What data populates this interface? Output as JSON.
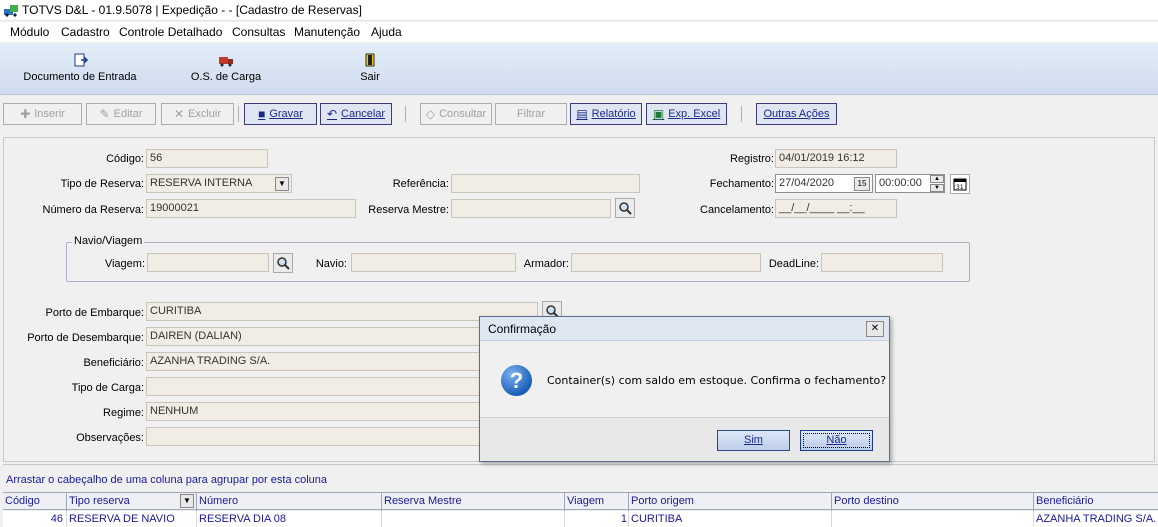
{
  "window": {
    "title": "TOTVS D&L - 01.9.5078 | Expedição - - [Cadastro de Reservas]"
  },
  "menu": [
    "Módulo",
    "Cadastro",
    "Controle Detalhado",
    "Consultas",
    "Manutenção",
    "Ajuda"
  ],
  "bigbar": [
    {
      "label": "Documento de Entrada",
      "icon": "document-entry-icon"
    },
    {
      "label": "O.S. de Carga",
      "icon": "truck-icon"
    },
    {
      "label": "Sair",
      "icon": "exit-door-icon"
    }
  ],
  "toolbar": {
    "inserir": "Inserir",
    "editar": "Editar",
    "excluir": "Excluir",
    "gravar": "Gravar",
    "cancelar": "Cancelar",
    "consultar": "Consultar",
    "filtrar": "Filtrar",
    "relatorio": "Relatório",
    "exp_excel": "Exp. Excel",
    "outras_acoes": "Outras Ações"
  },
  "form": {
    "codigo_label": "Código:",
    "codigo_value": "56",
    "tipo_reserva_label": "Tipo de Reserva:",
    "tipo_reserva_value": "RESERVA INTERNA",
    "numero_reserva_label": "Número da Reserva:",
    "numero_reserva_value": "19000021",
    "referencia_label": "Referência:",
    "referencia_value": "",
    "reserva_mestre_label": "Reserva Mestre:",
    "reserva_mestre_value": "",
    "registro_label": "Registro:",
    "registro_value": "04/01/2019 16:12",
    "fechamento_label": "Fechamento:",
    "fechamento_date": "27/04/2020",
    "fechamento_time": "00:00:00",
    "cancelamento_label": "Cancelamento:",
    "cancelamento_value": "__/__/____ __:__",
    "navio_group": "Navio/Viagem",
    "viagem_label": "Viagem:",
    "navio_label": "Navio:",
    "armador_label": "Armador:",
    "deadline_label": "DeadLine:",
    "porto_embarque_label": "Porto de Embarque:",
    "porto_embarque_value": "CURITIBA",
    "porto_desembarque_label": "Porto de Desembarque:",
    "porto_desembarque_value": "DAIREN (DALIAN)",
    "beneficiario_label": "Beneficiário:",
    "beneficiario_value": "AZANHA TRADING S/A.",
    "tipo_carga_label": "Tipo de Carga:",
    "tipo_carga_value": "",
    "regime_label": "Regime:",
    "regime_value": "NENHUM",
    "observacoes_label": "Observações:",
    "observacoes_value": ""
  },
  "grid": {
    "group_hint": "Arrastar o cabeçalho de uma coluna para agrupar por esta coluna",
    "columns": [
      "Código",
      "Tipo reserva",
      "Número",
      "Reserva Mestre",
      "Viagem",
      "Porto origem",
      "Porto destino",
      "Beneficiário"
    ],
    "row": {
      "codigo": "46",
      "tipo": "RESERVA DE NAVIO",
      "numero": "RESERVA DIA 08",
      "mestre": "",
      "viagem": "1",
      "origem": "CURITIBA",
      "destino": "",
      "beneficiario": "AZANHA TRADING S/A."
    }
  },
  "dialog": {
    "title": "Confirmação",
    "message": "Container(s) com saldo em estoque. Confirma o fechamento?",
    "yes": "Sim",
    "no": "Não"
  }
}
